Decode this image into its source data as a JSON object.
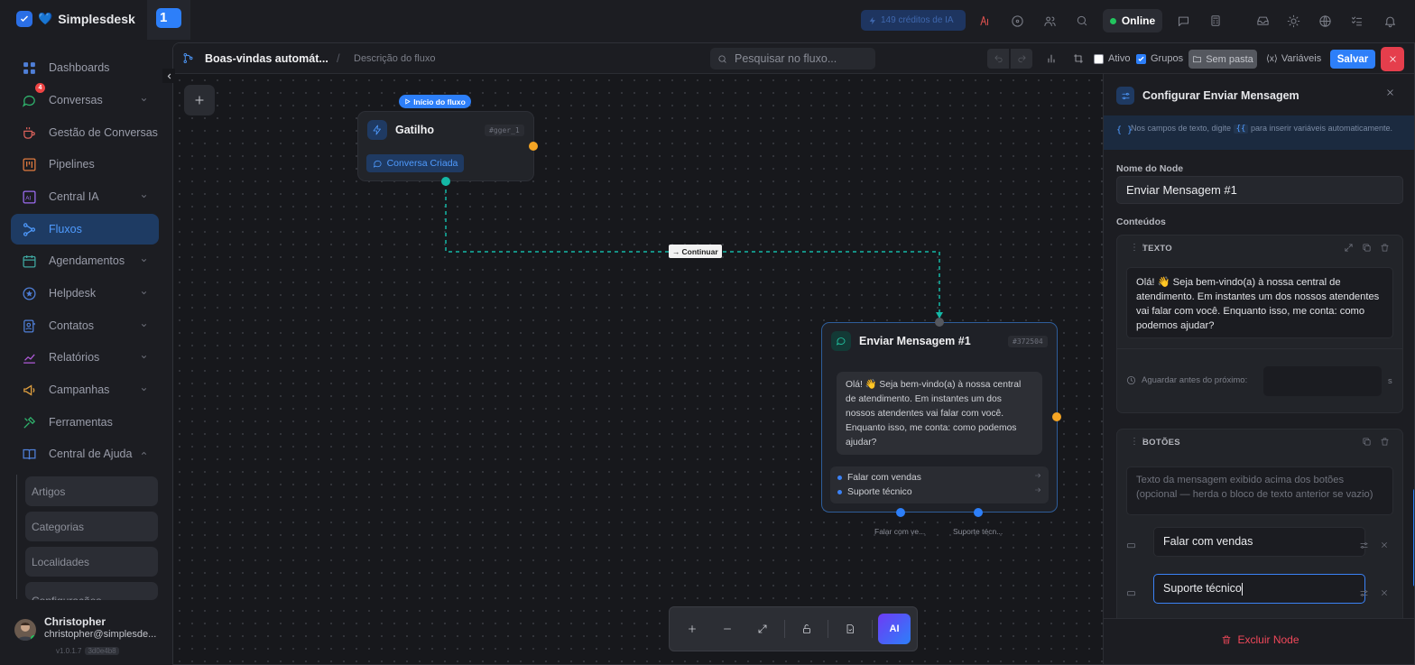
{
  "topbar": {
    "brand": "Simplesdesk",
    "brand_prefix": "💙",
    "workspace_badge": "1",
    "credits": "149 créditos de IA",
    "status": "Online"
  },
  "sidebar": {
    "items": [
      {
        "label": "Dashboards",
        "icon": "grid-icon"
      },
      {
        "label": "Conversas",
        "icon": "chat-icon",
        "badge": "4"
      },
      {
        "label": "Gestão de Conversas",
        "icon": "coffee-icon"
      },
      {
        "label": "Pipelines",
        "icon": "kanban-icon"
      },
      {
        "label": "Central IA",
        "icon": "ai-icon"
      },
      {
        "label": "Fluxos",
        "icon": "flow-icon"
      },
      {
        "label": "Agendamentos",
        "icon": "calendar-icon"
      },
      {
        "label": "Helpdesk",
        "icon": "star-icon"
      },
      {
        "label": "Contatos",
        "icon": "contacts-icon"
      },
      {
        "label": "Relatórios",
        "icon": "chart-icon"
      },
      {
        "label": "Campanhas",
        "icon": "megaphone-icon"
      },
      {
        "label": "Ferramentas",
        "icon": "tools-icon"
      },
      {
        "label": "Central de Ajuda",
        "icon": "book-icon"
      }
    ],
    "subitems": [
      "Artigos",
      "Categorias",
      "Localidades",
      "Configurações"
    ],
    "user": {
      "name": "Christopher",
      "email": "christopher@simplesde...",
      "version": "v1.0.1.7",
      "hash": "3d0e4b8"
    }
  },
  "flow_header": {
    "title": "Boas-vindas automát...",
    "description_placeholder": "Descrição do fluxo",
    "search_placeholder": "Pesquisar no fluxo...",
    "ativo_label": "Ativo",
    "grupos_label": "Grupos",
    "pasta_label": "Sem pasta",
    "variaveis_label": "Variáveis",
    "save_label": "Salvar"
  },
  "canvas": {
    "start_label": "Início do fluxo",
    "trigger": {
      "title": "Gatilho",
      "id": "#gger_1",
      "badge": "Conversa Criada"
    },
    "edge_label": "Continuar",
    "message_node": {
      "title": "Enviar Mensagem #1",
      "id": "#372504",
      "text": "Olá! 👋 Seja bem-vindo(a) à nossa central de atendimento. Em instantes um dos nossos atendentes vai falar com você. Enquanto isso, me conta: como podemos ajudar?",
      "buttons": [
        "Falar com vendas",
        "Suporte técnico"
      ],
      "outputs": [
        "Falar com ve...",
        "Suporte técn..."
      ]
    },
    "ai_label": "AI"
  },
  "config_panel": {
    "title": "Configurar Enviar Mensagem",
    "hint_before": "Nos campos de texto, digite",
    "hint_code": "{{",
    "hint_after": "para inserir variáveis automaticamente.",
    "node_name_label": "Nome do Node",
    "node_name_value": "Enviar Mensagem #1",
    "contents_label": "Conteúdos",
    "text_section_title": "TEXTO",
    "text_value": "Olá! 👋 Seja bem-vindo(a) à nossa central de atendimento. Em instantes um dos nossos atendentes vai falar com você. Enquanto isso, me conta: como podemos ajudar?",
    "wait_label": "Aguardar antes do próximo:",
    "wait_unit": "s",
    "buttons_section_title": "BOTÕES",
    "buttons_text_placeholder": "Texto da mensagem exibido acima dos botões (opcional — herda o bloco de texto anterior se vazio)",
    "button_values": [
      "Falar com vendas",
      "Suporte técnico"
    ],
    "delete_label": "Excluir Node"
  },
  "colors": {
    "accent": "#2d7ff9",
    "success": "#22c55e",
    "danger": "#e53e4c",
    "edge": "#14b8a6",
    "handle": "#f59e0b"
  }
}
